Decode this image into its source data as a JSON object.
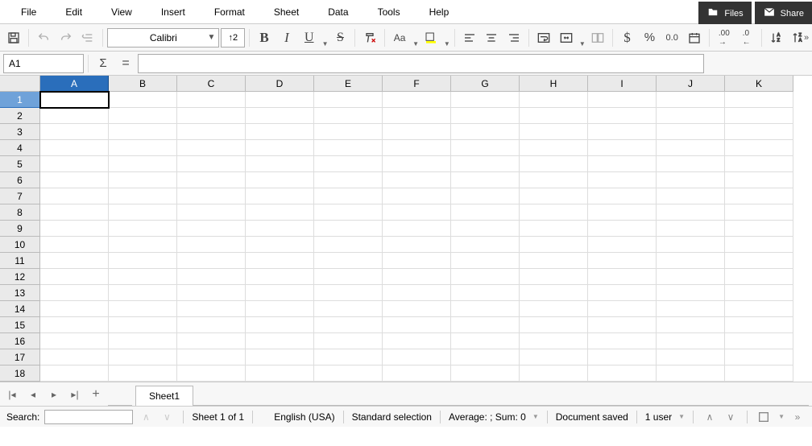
{
  "menu": [
    "File",
    "Edit",
    "View",
    "Insert",
    "Format",
    "Sheet",
    "Data",
    "Tools",
    "Help"
  ],
  "top_buttons": {
    "files": "Files",
    "share": "Share"
  },
  "toolbar": {
    "font_name": "Calibri",
    "font_size_display": "↑2",
    "case": "Aa"
  },
  "name_box": "A1",
  "formula_value": "",
  "columns": [
    "A",
    "B",
    "C",
    "D",
    "E",
    "F",
    "G",
    "H",
    "I",
    "J",
    "K"
  ],
  "rows": [
    "1",
    "2",
    "3",
    "4",
    "5",
    "6",
    "7",
    "8",
    "9",
    "10",
    "11",
    "12",
    "13",
    "14",
    "15",
    "16",
    "17",
    "18"
  ],
  "selected_col": "A",
  "selected_row": "1",
  "tabs": {
    "sheet_label": "Sheet1"
  },
  "status": {
    "search_label": "Search:",
    "sheet_info": "Sheet 1 of 1",
    "language": "English (USA)",
    "selection_mode": "Standard selection",
    "summary": "Average: ; Sum: 0",
    "save_state": "Document saved",
    "users": "1 user"
  }
}
